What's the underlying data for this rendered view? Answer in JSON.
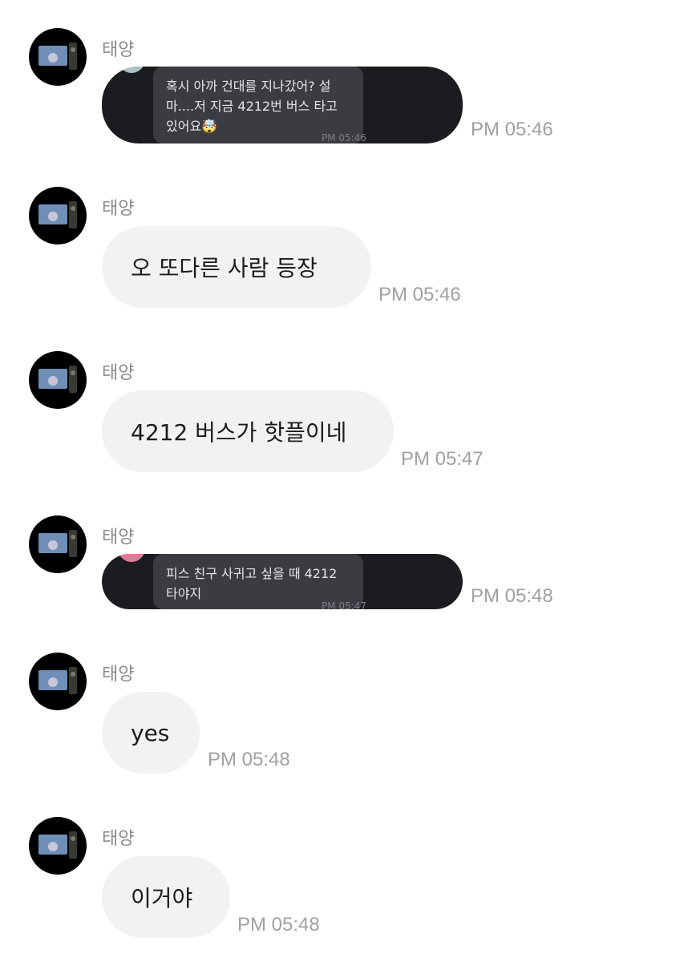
{
  "messages": [
    {
      "sender": "태양",
      "type": "image",
      "image_text": "혹시 아까 건대를 지나갔어? 설\n마....저 지금 4212번 버스 타고\n있어요🤯",
      "image_time": "PM 05:46",
      "time": "PM 05:46"
    },
    {
      "sender": "태양",
      "type": "text",
      "text": "오 또다른 사람 등장",
      "time": "PM 05:46"
    },
    {
      "sender": "태양",
      "type": "text",
      "text": "4212 버스가 핫플이네",
      "time": "PM 05:47"
    },
    {
      "sender": "태양",
      "type": "image",
      "image_text": "피스 친구 사귀고 싶을 때 4212\n타야지",
      "image_time": "PM 05:47",
      "time": "PM 05:48"
    },
    {
      "sender": "태양",
      "type": "text",
      "text": "yes",
      "time": "PM 05:48"
    },
    {
      "sender": "태양",
      "type": "text",
      "text": "이거야",
      "time": "PM 05:48"
    }
  ],
  "colors": {
    "bubble": "#f2f2f5",
    "dark_shot": "#1b1c20",
    "peek_1": "#a8c3c3",
    "peek_2": "#e8789a"
  },
  "icons": {
    "avatar": "profile-avatar-icon"
  }
}
